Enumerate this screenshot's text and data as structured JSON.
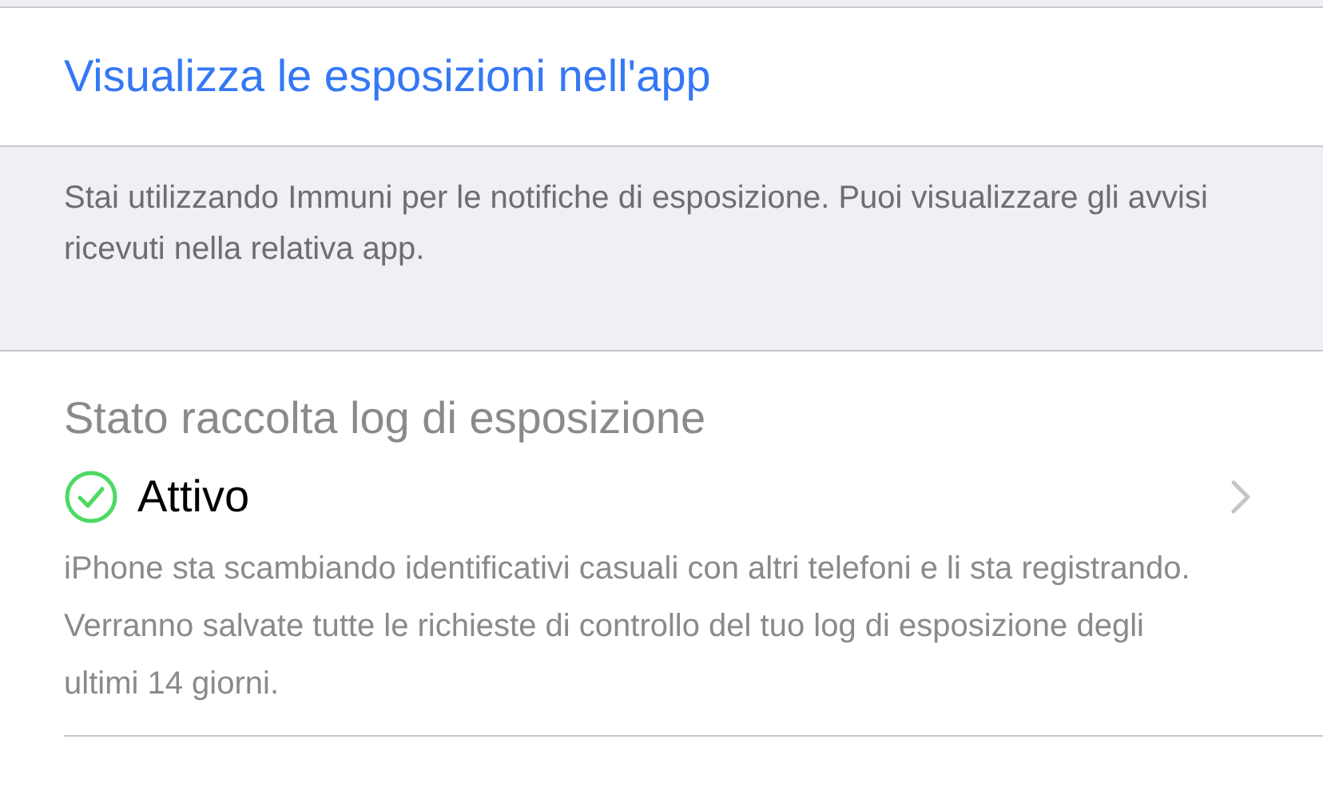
{
  "link": {
    "label": "Visualizza le esposizioni nell'app"
  },
  "note": "Stai utilizzando Immuni per le notifiche di esposizione. Puoi visualizzare gli avvisi ricevuti nella relativa app.",
  "log_status": {
    "title": "Stato raccolta log di esposizione",
    "status": "Attivo",
    "active": true,
    "description": "iPhone sta scambiando identificativi casuali con altri telefoni e li sta registrando. Verranno salvate tutte le richieste di controllo del tuo log di esposizione degli ultimi 14 giorni."
  }
}
